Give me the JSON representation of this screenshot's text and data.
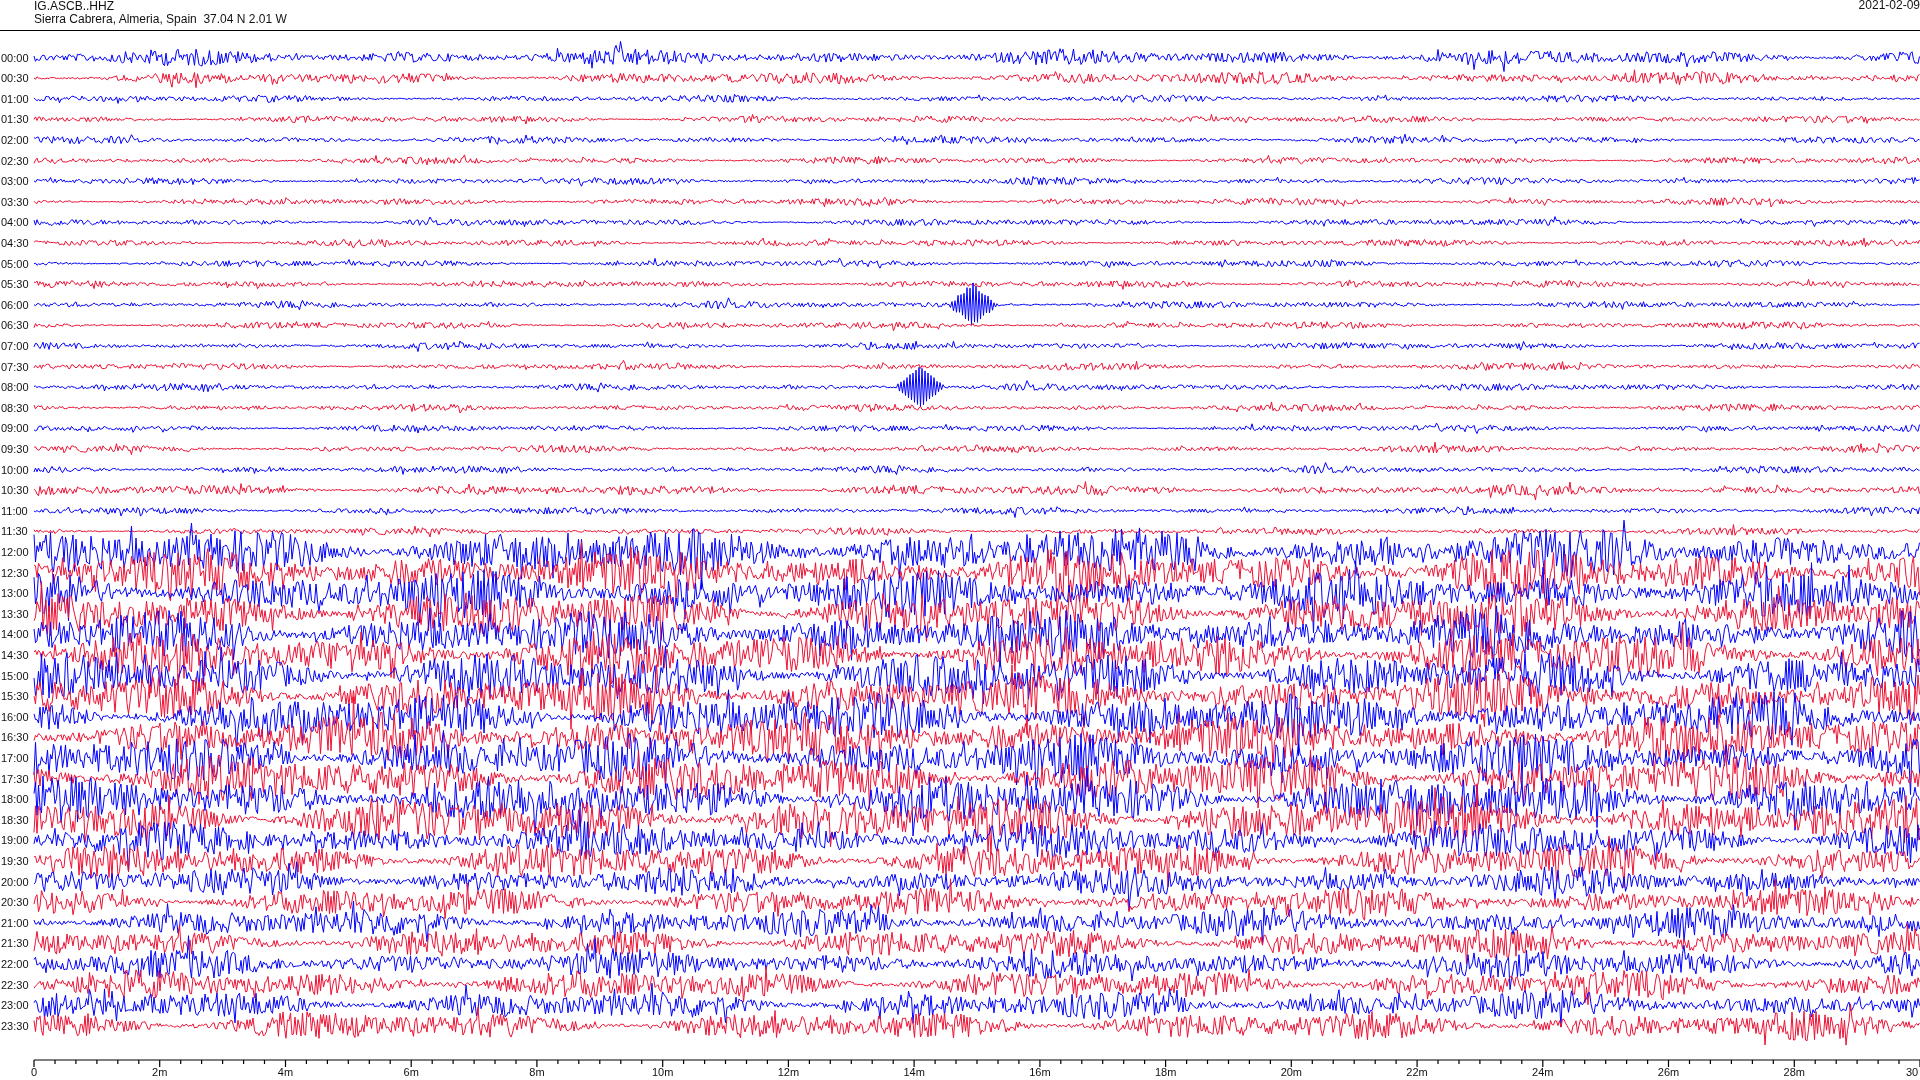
{
  "header": {
    "channel": "IG.ASCB..HHZ",
    "station": "Sierra Cabrera, Almeria, Spain  37.04 N 2.01 W",
    "date": "2021-02-09"
  },
  "helicorder": {
    "row_labels": [
      "00:00",
      "00:30",
      "01:00",
      "01:30",
      "02:00",
      "02:30",
      "03:00",
      "03:30",
      "04:00",
      "04:30",
      "05:00",
      "05:30",
      "06:00",
      "06:30",
      "07:00",
      "07:30",
      "08:00",
      "08:30",
      "09:00",
      "09:30",
      "10:00",
      "10:30",
      "11:00",
      "11:30",
      "12:00",
      "12:30",
      "13:00",
      "13:30",
      "14:00",
      "14:30",
      "15:00",
      "15:30",
      "16:00",
      "16:30",
      "17:00",
      "17:30",
      "18:00",
      "18:30",
      "19:00",
      "19:30",
      "20:00",
      "20:30",
      "21:00",
      "21:30",
      "22:00",
      "22:30",
      "23:00",
      "23:30"
    ],
    "x_ticks": [
      "0",
      "2m",
      "4m",
      "6m",
      "8m",
      "10m",
      "12m",
      "14m",
      "16m",
      "18m",
      "20m",
      "22m",
      "24m",
      "26m",
      "28m",
      "30"
    ]
  }
}
